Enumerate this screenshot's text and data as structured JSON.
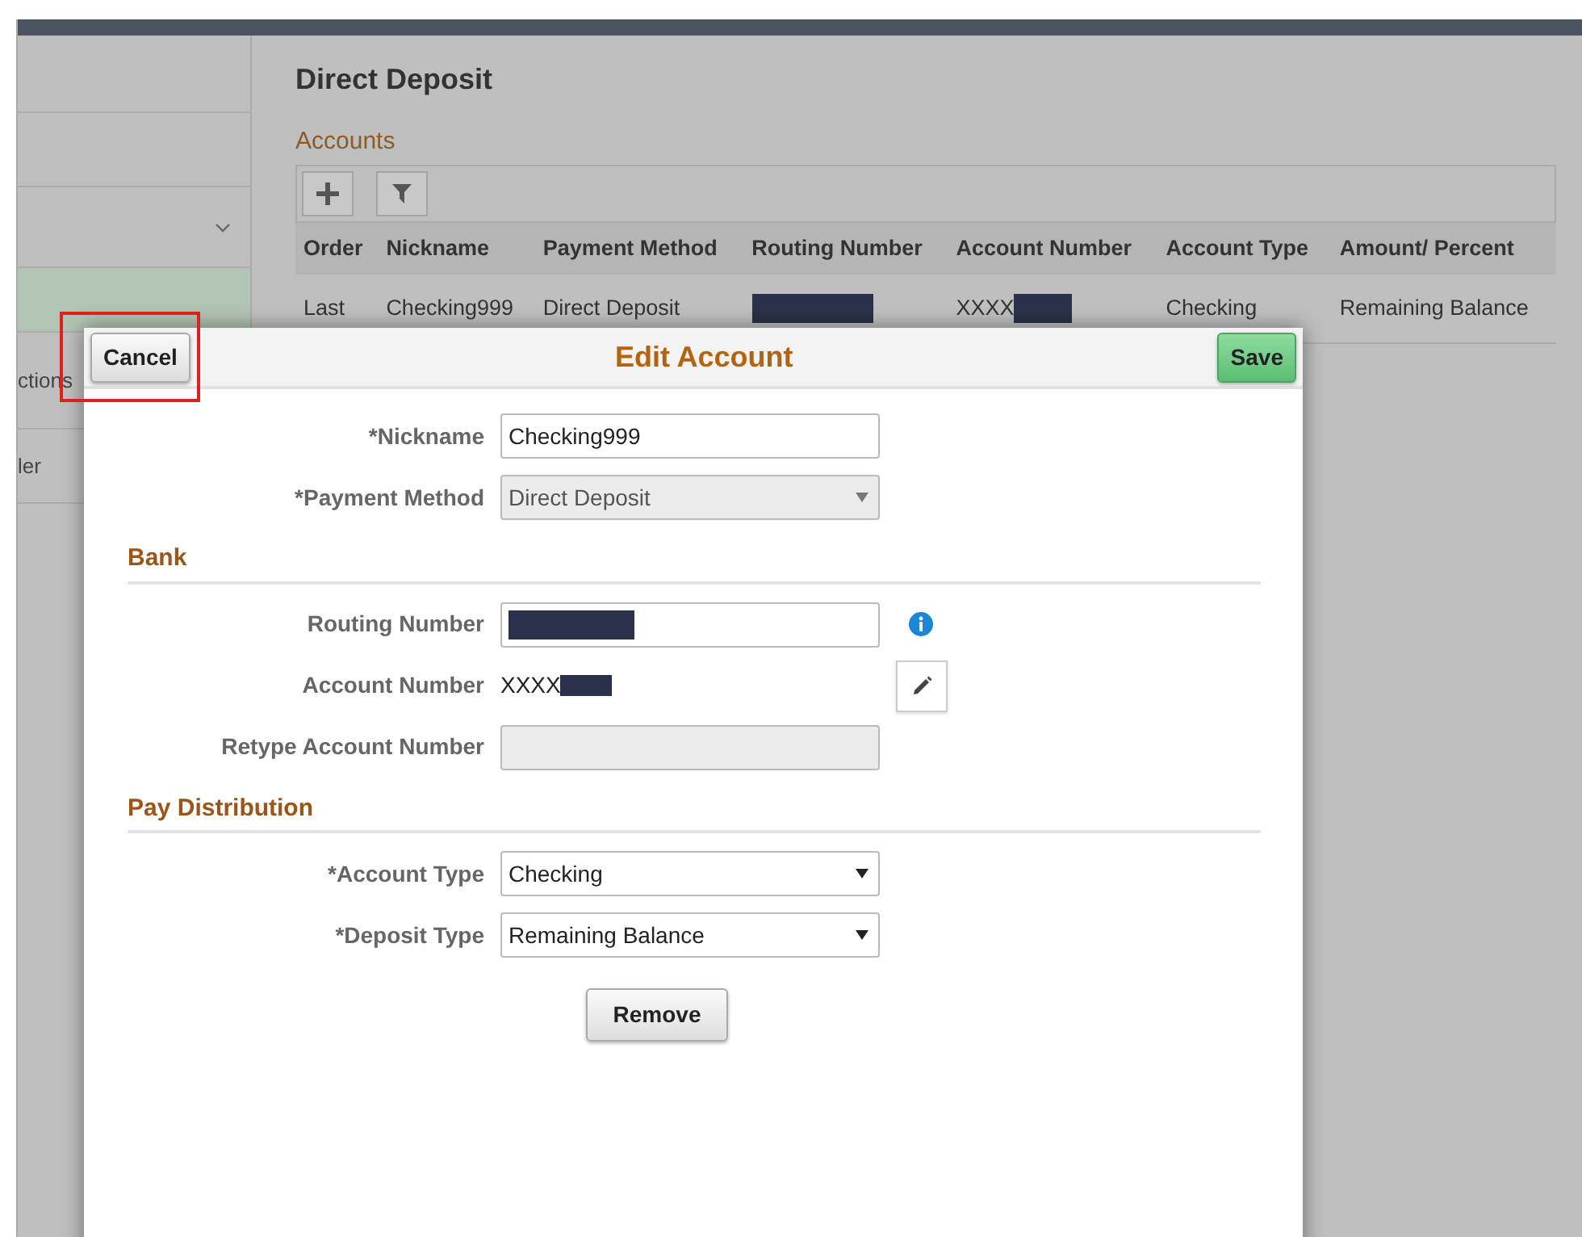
{
  "sidebar": {
    "items": [
      {
        "kind": "plain",
        "selected": false
      },
      {
        "kind": "plain",
        "selected": false
      },
      {
        "kind": "dropdown",
        "selected": false
      },
      {
        "kind": "plain",
        "selected": true
      },
      {
        "kind": "text",
        "label": "ctions",
        "selected": false
      },
      {
        "kind": "text",
        "label": "ler",
        "selected": false
      }
    ]
  },
  "page": {
    "title": "Direct Deposit",
    "section": "Accounts",
    "toolbar": [
      {
        "kind": "add"
      },
      {
        "kind": "filter"
      }
    ],
    "table": {
      "columns": [
        "Order",
        "Nickname",
        "Payment Method",
        "Routing Number",
        "Account Number",
        "Account Type",
        "Amount/ Percent"
      ],
      "rows": [
        {
          "cells": [
            {
              "text": "Last",
              "redacted": false
            },
            {
              "text": "Checking999",
              "redacted": false
            },
            {
              "text": "Direct Deposit",
              "redacted": false
            },
            {
              "redacted": true
            },
            {
              "text": "XXXX",
              "redacted": true
            },
            {
              "text": "Checking",
              "redacted": false
            },
            {
              "text": "Remaining Balance",
              "redacted": false
            }
          ]
        }
      ]
    }
  },
  "modal": {
    "title": "Edit Account",
    "cancel_button": "Cancel",
    "save_button": "Save",
    "form": [
      {
        "kind": "text",
        "label": "*Nickname",
        "value": "Checking999",
        "disabled": false
      },
      {
        "kind": "select",
        "label": "*Payment Method",
        "value": "Direct Deposit",
        "disabled": true
      },
      {
        "kind": "heading",
        "label": "Bank"
      },
      {
        "kind": "text",
        "label": "Routing Number",
        "redacted": true,
        "info": true,
        "disabled": false
      },
      {
        "kind": "readonly",
        "label": "Account Number",
        "value": "XXXX",
        "redacted": true,
        "edit_button": true
      },
      {
        "kind": "text",
        "label": "Retype Account Number",
        "disabled": true
      },
      {
        "kind": "heading",
        "label": "Pay Distribution"
      },
      {
        "kind": "select",
        "label": "*Account Type",
        "value": "Checking",
        "disabled": false
      },
      {
        "kind": "select",
        "label": "*Deposit Type",
        "value": "Remaining Balance",
        "disabled": false
      }
    ],
    "remove_button": "Remove",
    "cancel_highlighted": true
  }
}
